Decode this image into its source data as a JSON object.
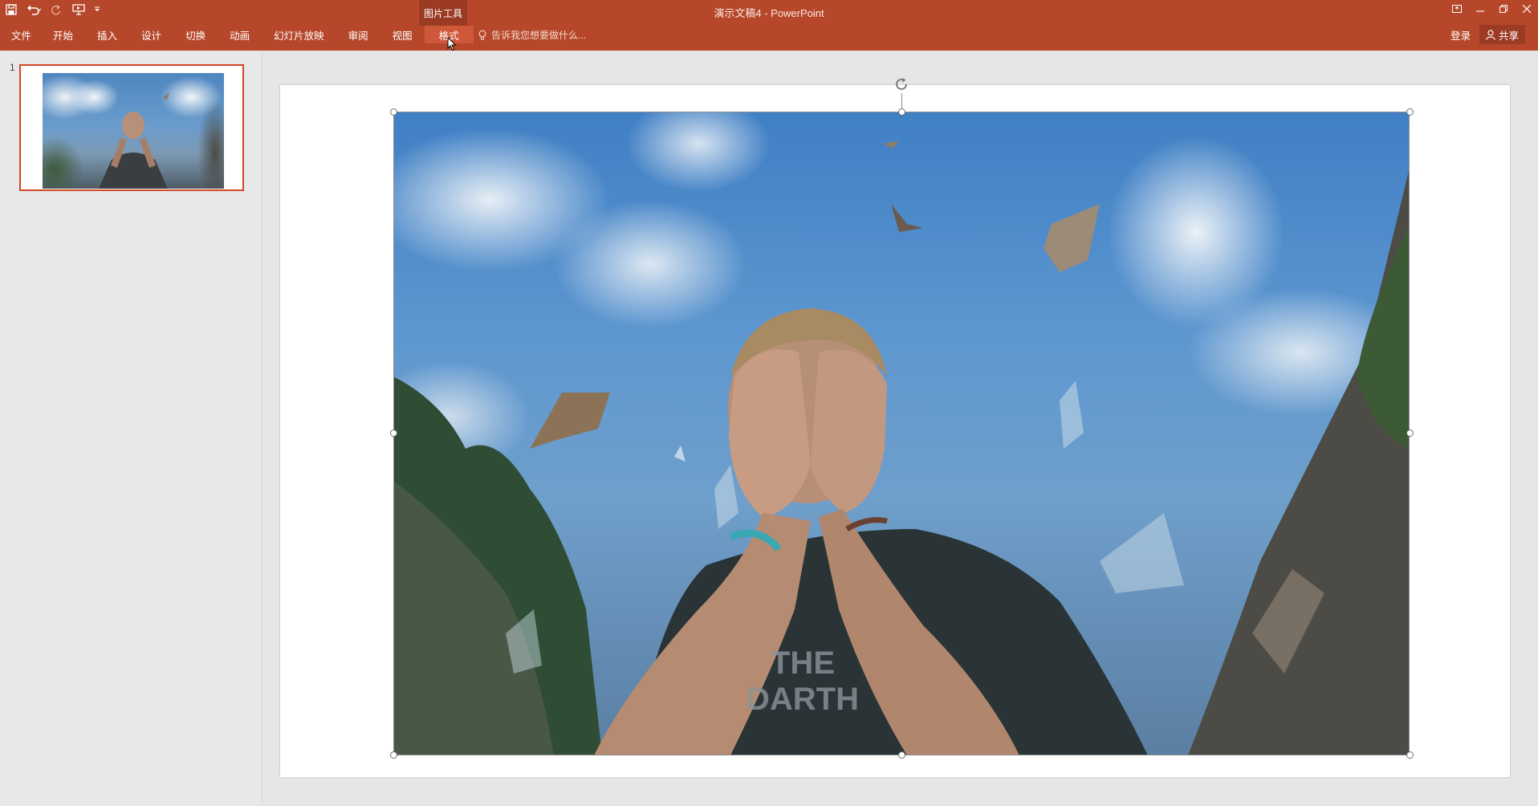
{
  "window": {
    "title": "演示文稿4 - PowerPoint",
    "context_group": "图片工具"
  },
  "ribbon": {
    "tabs": [
      {
        "label": "文件"
      },
      {
        "label": "开始"
      },
      {
        "label": "插入"
      },
      {
        "label": "设计"
      },
      {
        "label": "切换"
      },
      {
        "label": "动画"
      },
      {
        "label": "幻灯片放映"
      },
      {
        "label": "审阅"
      },
      {
        "label": "视图"
      },
      {
        "label": "格式",
        "active": true
      }
    ],
    "tell_me": "告诉我您想要做什么...",
    "sign_in": "登录",
    "share": "共享"
  },
  "thumbnails": [
    {
      "number": "1",
      "selected": true
    }
  ],
  "colors": {
    "accent": "#b7472a",
    "active_tab": "#d0583a",
    "thumb_selected": "#d24726"
  },
  "icons": [
    "save-icon",
    "undo-icon",
    "redo-icon",
    "start-from-beginning-icon",
    "customize-qat-icon",
    "ribbon-display-icon",
    "minimize-icon",
    "restore-icon",
    "close-icon",
    "lightbulb-icon",
    "person-icon",
    "rotate-icon"
  ]
}
